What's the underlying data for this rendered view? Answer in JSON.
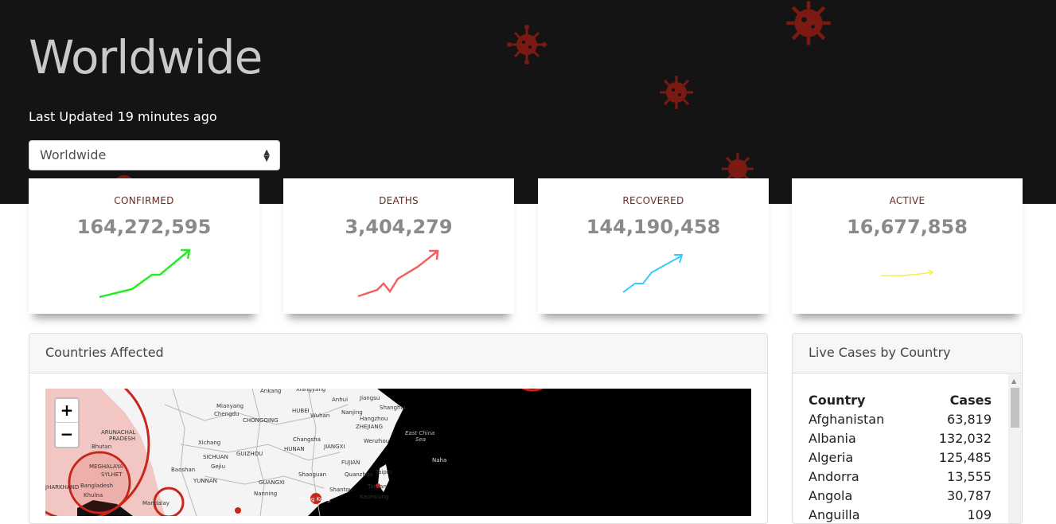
{
  "header": {
    "title": "Worldwide",
    "updated": "Last Updated 19 minutes ago",
    "select_value": "Worldwide"
  },
  "stats": [
    {
      "label": "CONFIRMED",
      "value": "164,272,595",
      "color": "#22ee22"
    },
    {
      "label": "DEATHS",
      "value": "3,404,279",
      "color": "#f06060"
    },
    {
      "label": "RECOVERED",
      "value": "144,190,458",
      "color": "#33ccff"
    },
    {
      "label": "ACTIVE",
      "value": "16,677,858",
      "color": "#f2f24a"
    }
  ],
  "map_panel": {
    "title": "Countries Affected",
    "zoom_in": "+",
    "zoom_out": "−",
    "labels": [
      "Ankang",
      "Xiangyang",
      "Anhui",
      "Jiangsu",
      "Shanghai",
      "Mianyang",
      "Chengdu",
      "CHONGQING",
      "HUBEI",
      "Wuhan",
      "Nanjing",
      "Hangzhou",
      "Changsha",
      "HUNAN",
      "JIANGXI",
      "ZHEJIANG",
      "Wenzhou",
      "SICHUAN",
      "GUIZHOU",
      "Xichang",
      "FUJIAN",
      "Taipei",
      "Taiwan",
      "Kaohsiung",
      "YUNNAN",
      "GUANGXI",
      "Quanzhou",
      "Shaoguan",
      "Shantou",
      "Baoshan",
      "Gejiu",
      "Nanning",
      "Hong Kong",
      "East China Sea",
      "Naha",
      "Bhutan",
      "Bangladesh",
      "ARUNACHAL PRADESH",
      "MEGHALAYA",
      "SYLHET",
      "Khulna",
      "JHARKHAND",
      "Mandalay"
    ]
  },
  "cases_panel": {
    "title": "Live Cases by Country",
    "col_country": "Country",
    "col_cases": "Cases",
    "rows": [
      {
        "country": "Afghanistan",
        "cases": "63,819"
      },
      {
        "country": "Albania",
        "cases": "132,032"
      },
      {
        "country": "Algeria",
        "cases": "125,485"
      },
      {
        "country": "Andorra",
        "cases": "13,555"
      },
      {
        "country": "Angola",
        "cases": "30,787"
      },
      {
        "country": "Anguilla",
        "cases": "109"
      }
    ]
  }
}
